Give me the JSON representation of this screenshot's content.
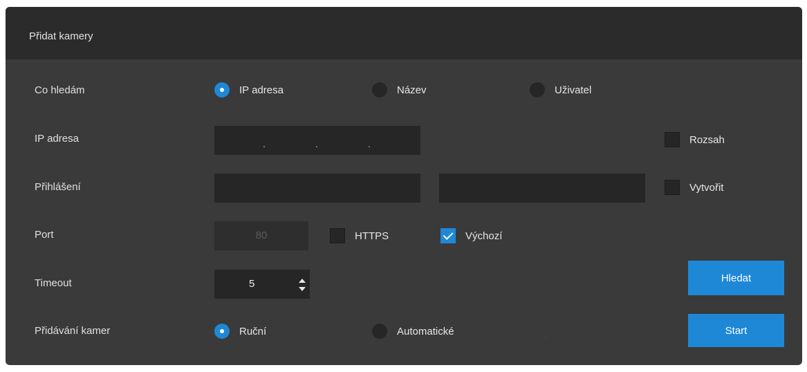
{
  "dialog": {
    "title": "Přidat kamery"
  },
  "search_mode": {
    "label": "Co hledám",
    "options": [
      {
        "label": "IP adresa",
        "checked": true
      },
      {
        "label": "Název",
        "checked": false
      },
      {
        "label": "Uživatel",
        "checked": false
      }
    ]
  },
  "ip_address": {
    "label": "IP adresa",
    "separators": [
      ".",
      ".",
      "."
    ],
    "range": {
      "label": "Rozsah",
      "checked": false
    }
  },
  "login": {
    "label": "Přihlášení",
    "username_value": "",
    "password_value": "",
    "create": {
      "label": "Vytvořit",
      "checked": false
    }
  },
  "port": {
    "label": "Port",
    "value": "80",
    "https": {
      "label": "HTTPS",
      "checked": false
    },
    "default": {
      "label": "Výchozí",
      "checked": true
    }
  },
  "timeout": {
    "label": "Timeout",
    "value": "5"
  },
  "adding": {
    "label": "Přidávání kamer",
    "options": [
      {
        "label": "Ruční",
        "checked": true
      },
      {
        "label": "Automatické",
        "checked": false
      }
    ],
    "dots": "..."
  },
  "buttons": {
    "search": "Hledat",
    "start": "Start"
  },
  "colors": {
    "accent": "#1e88d6",
    "panel": "#3a3a3a",
    "header": "#2b2b2b",
    "field": "#262626"
  }
}
